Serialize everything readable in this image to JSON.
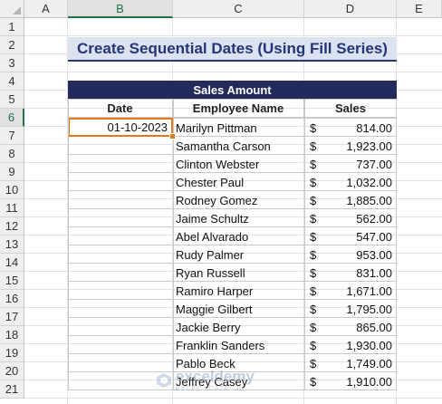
{
  "columns": [
    "A",
    "B",
    "C",
    "D",
    "E"
  ],
  "rows": [
    "1",
    "2",
    "3",
    "4",
    "5",
    "6",
    "7",
    "8",
    "9",
    "10",
    "11",
    "12",
    "13",
    "14",
    "15",
    "16",
    "17",
    "18",
    "19",
    "20",
    "21"
  ],
  "active_column": "B",
  "active_row": "6",
  "title": "Create Sequential Dates (Using Fill Series)",
  "table": {
    "banner": "Sales Amount",
    "headers": {
      "date": "Date",
      "name": "Employee Name",
      "sales": "Sales"
    },
    "selected_date": "01-10-2023",
    "currency": "$",
    "rows": [
      {
        "name": "Marilyn Pittman",
        "sales": "814.00"
      },
      {
        "name": "Samantha Carson",
        "sales": "1,923.00"
      },
      {
        "name": "Clinton Webster",
        "sales": "737.00"
      },
      {
        "name": "Chester Paul",
        "sales": "1,032.00"
      },
      {
        "name": "Rodney Gomez",
        "sales": "1,885.00"
      },
      {
        "name": "Jaime Schultz",
        "sales": "562.00"
      },
      {
        "name": "Abel Alvarado",
        "sales": "547.00"
      },
      {
        "name": "Rudy Palmer",
        "sales": "953.00"
      },
      {
        "name": "Ryan Russell",
        "sales": "831.00"
      },
      {
        "name": "Ramiro Harper",
        "sales": "1,671.00"
      },
      {
        "name": "Maggie Gilbert",
        "sales": "1,795.00"
      },
      {
        "name": "Jackie Berry",
        "sales": "865.00"
      },
      {
        "name": "Franklin Sanders",
        "sales": "1,930.00"
      },
      {
        "name": "Pablo Beck",
        "sales": "1,749.00"
      },
      {
        "name": "Jeffrey Casey",
        "sales": "1,910.00"
      }
    ]
  },
  "watermark": {
    "name": "exceldemy",
    "tagline": "EXCEL · DATA · BI"
  },
  "colors": {
    "accent": "#217346",
    "selection": "#e07b17",
    "banner": "#232b5c",
    "title_fill": "#dbe3f1",
    "title_text": "#263478"
  }
}
